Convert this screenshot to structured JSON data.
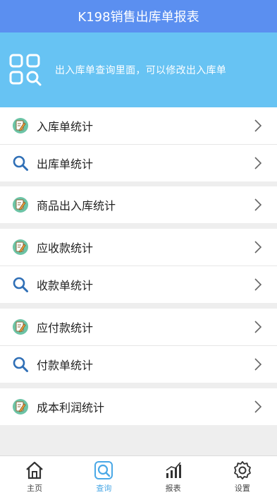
{
  "header": {
    "title": "K198销售出库单报表"
  },
  "banner": {
    "text": "出入库单查询里面，可以修改出入库单",
    "icon": "grid-search-icon"
  },
  "groups": [
    {
      "items": [
        {
          "label": "入库单统计",
          "icon": "edit-note-icon"
        },
        {
          "label": "出库单统计",
          "icon": "magnifier-icon"
        }
      ]
    },
    {
      "items": [
        {
          "label": "商品出入库统计",
          "icon": "edit-note-icon"
        }
      ]
    },
    {
      "items": [
        {
          "label": "应收款统计",
          "icon": "edit-note-icon"
        },
        {
          "label": "收款单统计",
          "icon": "magnifier-icon"
        }
      ]
    },
    {
      "items": [
        {
          "label": "应付款统计",
          "icon": "edit-note-icon"
        },
        {
          "label": "付款单统计",
          "icon": "magnifier-icon"
        }
      ]
    },
    {
      "items": [
        {
          "label": "成本利润统计",
          "icon": "edit-note-icon"
        }
      ]
    }
  ],
  "tabs": [
    {
      "label": "主页",
      "icon": "home-icon",
      "active": false
    },
    {
      "label": "查询",
      "icon": "search-tab-icon",
      "active": true
    },
    {
      "label": "报表",
      "icon": "chart-icon",
      "active": false
    },
    {
      "label": "设置",
      "icon": "gear-icon",
      "active": false
    }
  ],
  "colors": {
    "header": "#5b8ff0",
    "banner": "#67c3f3",
    "active_tab": "#4aa8e6"
  }
}
